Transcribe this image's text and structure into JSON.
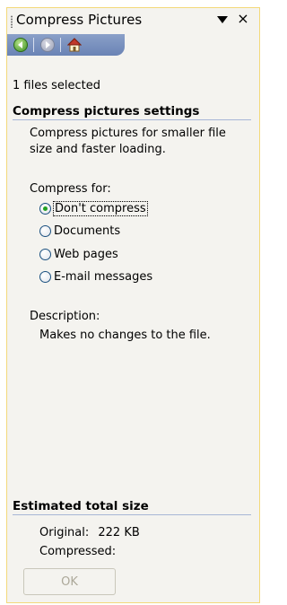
{
  "pane": {
    "title": "Compress Pictures",
    "menu_icon": "dropdown-triangle-icon",
    "close_symbol": "×"
  },
  "toolbar": {
    "back_icon": "back-arrow-icon",
    "forward_icon": "forward-arrow-icon",
    "home_icon": "home-icon"
  },
  "selection": {
    "text": "1 files selected"
  },
  "settings": {
    "heading": "Compress pictures settings",
    "intro": "Compress pictures for smaller file size and faster loading.",
    "compress_for_label": "Compress for:",
    "options": [
      {
        "label": "Don't compress",
        "selected": true
      },
      {
        "label": "Documents",
        "selected": false
      },
      {
        "label": "Web pages",
        "selected": false
      },
      {
        "label": "E-mail messages",
        "selected": false
      }
    ],
    "description_label": "Description:",
    "description_text": "Makes no changes to the file."
  },
  "estimate": {
    "heading": "Estimated total size",
    "original_label": "Original:",
    "original_value": "222 KB",
    "compressed_label": "Compressed:",
    "compressed_value": ""
  },
  "actions": {
    "ok_label": "OK",
    "ok_enabled": false
  },
  "colors": {
    "pane_background": "#f4f3ef",
    "pane_border": "#f3d97a",
    "toolbar_blue": "#7890c0",
    "section_rule": "#a7b6d6",
    "radio_selected": "#21a121",
    "disabled_text": "#aca899"
  }
}
